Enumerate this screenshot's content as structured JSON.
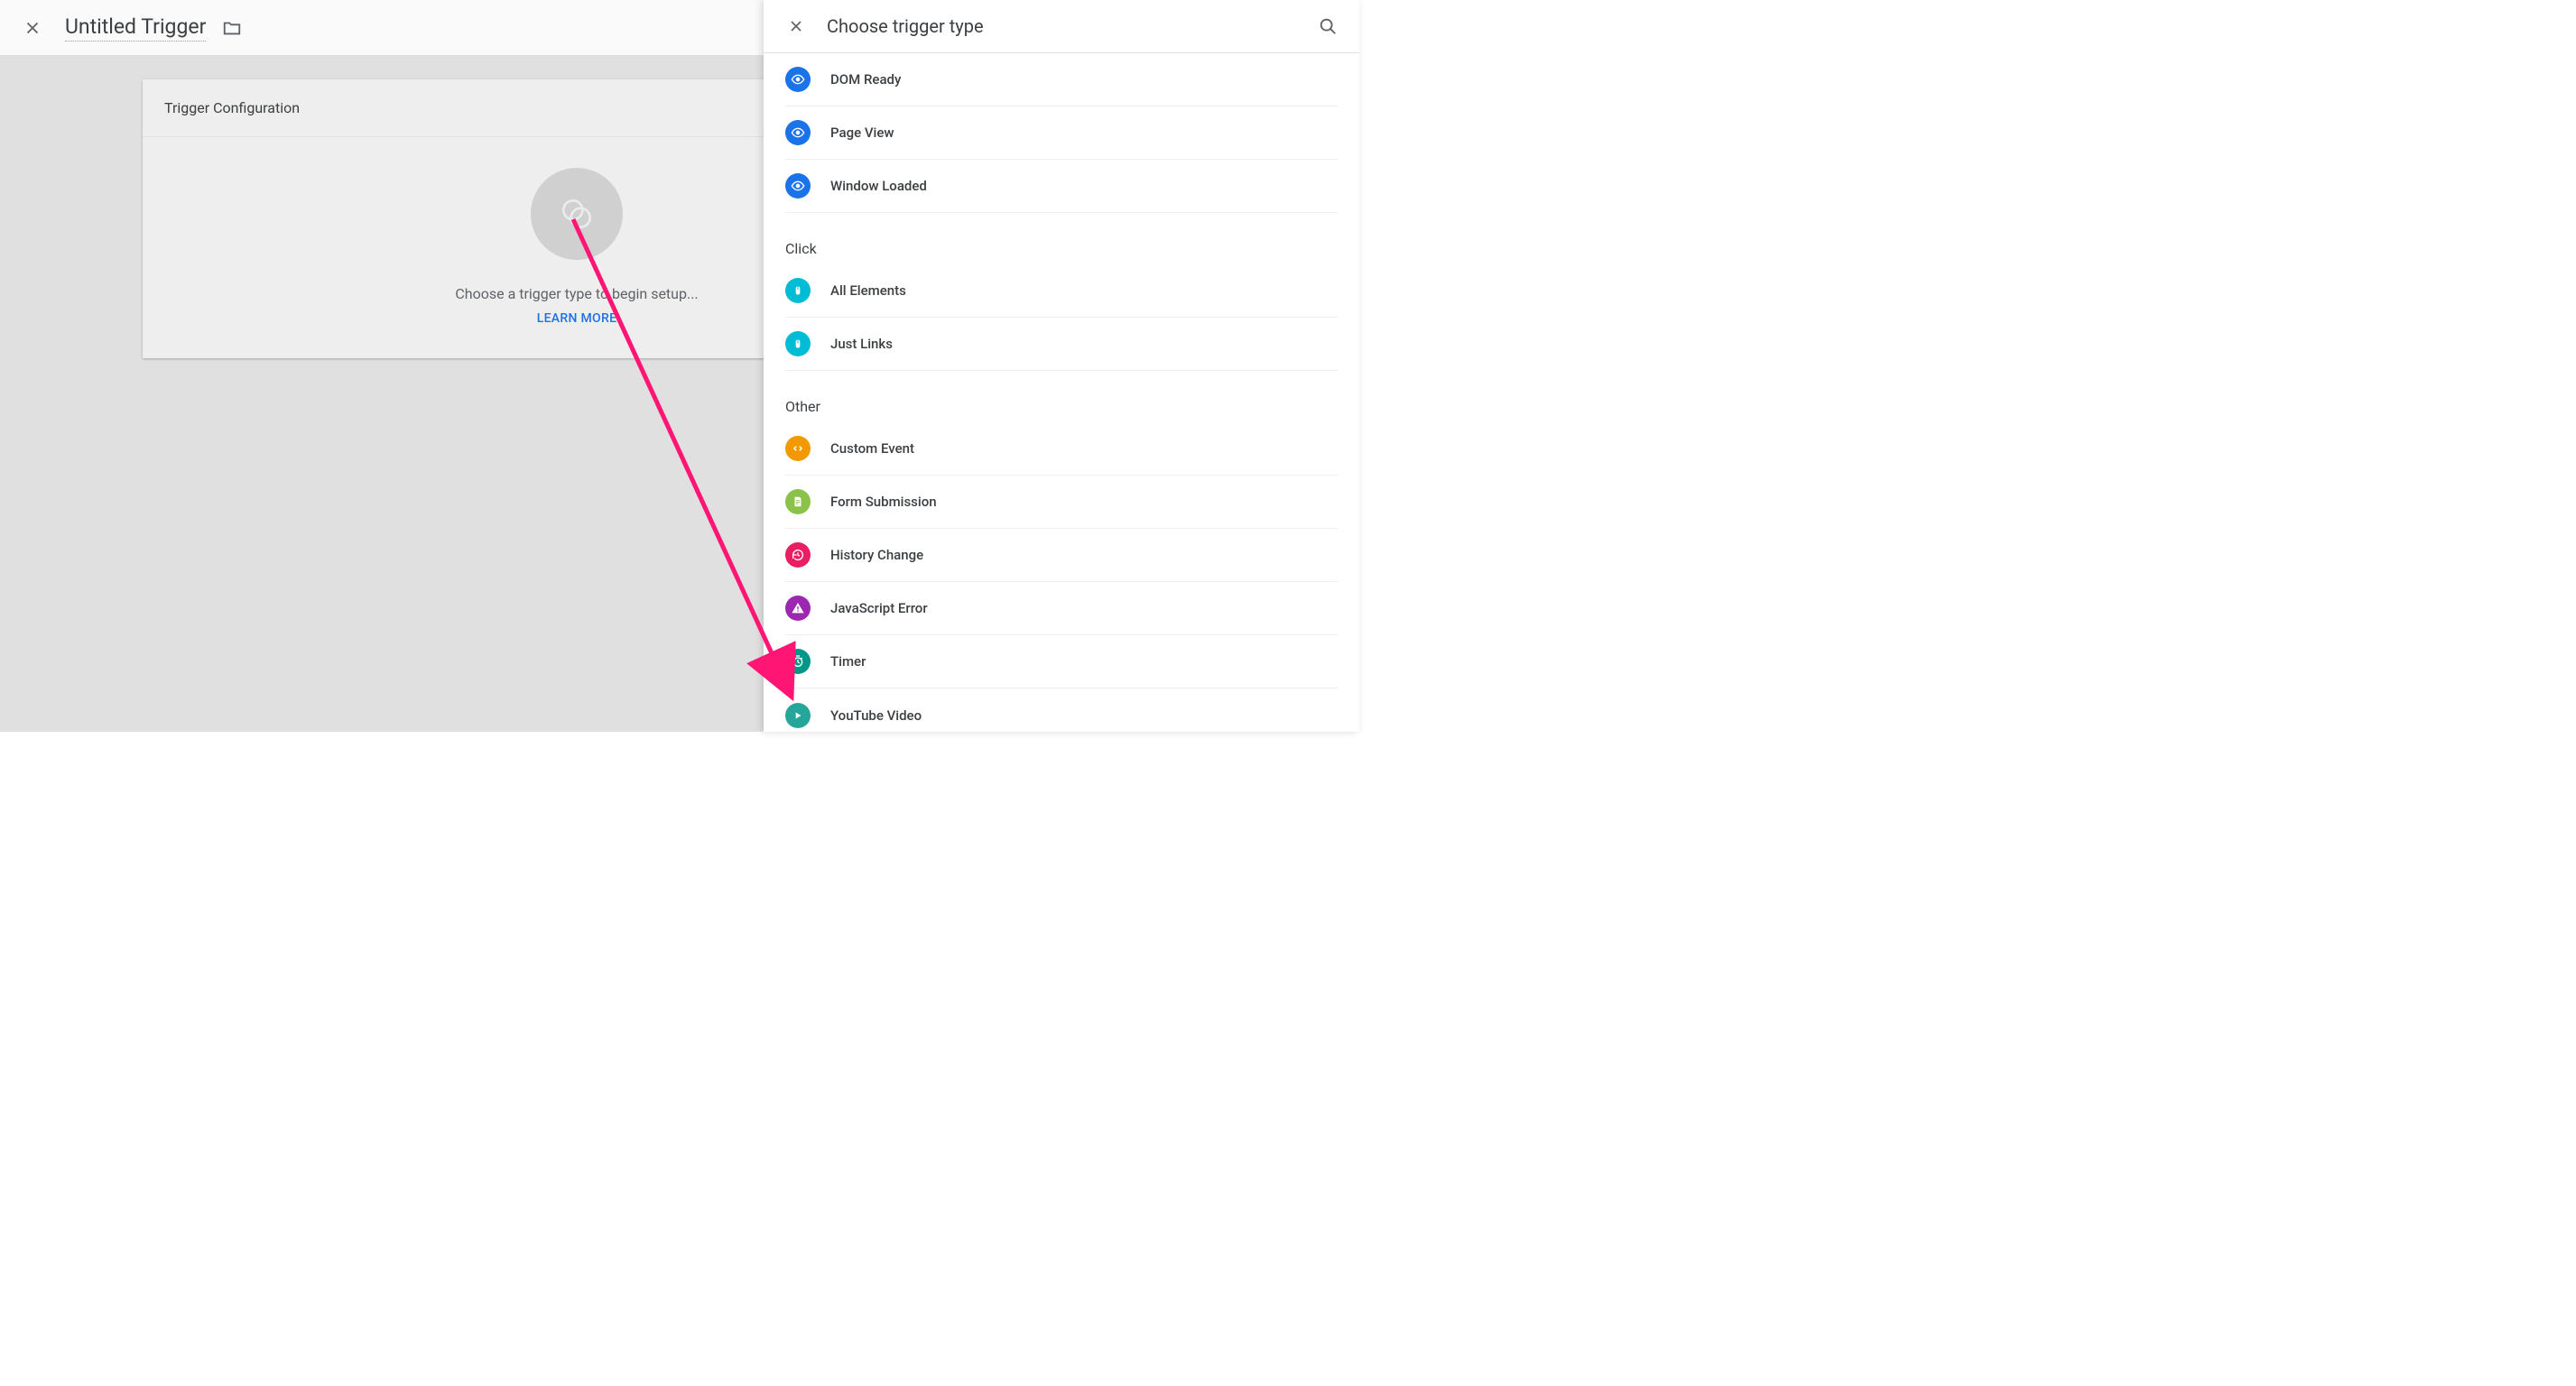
{
  "editor": {
    "title": "Untitled Trigger",
    "card_header": "Trigger Configuration",
    "prompt": "Choose a trigger type to begin setup...",
    "learn_more": "LEARN MORE"
  },
  "panel": {
    "title": "Choose trigger type",
    "pageview_items": [
      {
        "label": "DOM Ready"
      },
      {
        "label": "Page View"
      },
      {
        "label": "Window Loaded"
      }
    ],
    "click_section": "Click",
    "click_items": [
      {
        "label": "All Elements"
      },
      {
        "label": "Just Links"
      }
    ],
    "other_section": "Other",
    "other_items": [
      {
        "label": "Custom Event"
      },
      {
        "label": "Form Submission"
      },
      {
        "label": "History Change"
      },
      {
        "label": "JavaScript Error"
      },
      {
        "label": "Timer"
      },
      {
        "label": "YouTube Video"
      }
    ]
  }
}
